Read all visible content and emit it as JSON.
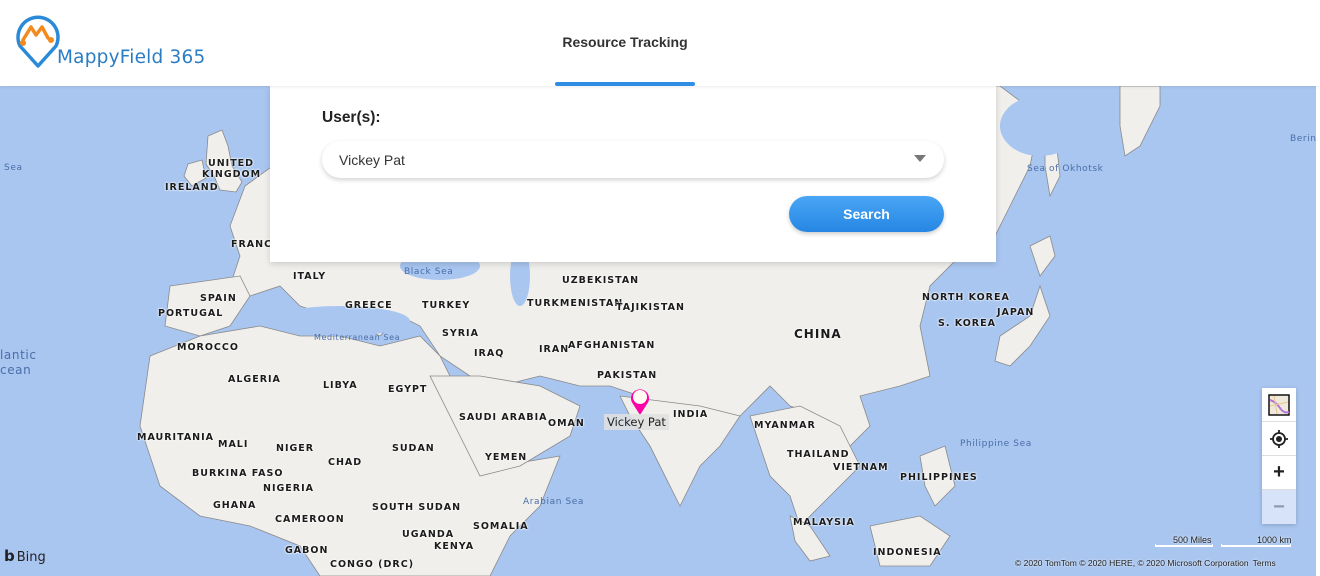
{
  "header": {
    "logo_text": "MappyField 365",
    "tabs": [
      {
        "label": "Resource Tracking",
        "active": true
      }
    ]
  },
  "panel": {
    "users_label": "User(s):",
    "selected_user": "Vickey Pat",
    "search_label": "Search"
  },
  "map": {
    "marker": {
      "label": "Vickey Pat",
      "color": "#ff00a8"
    },
    "countries": [
      "UNITED",
      "KINGDOM",
      "IRELAND",
      "FRANCE",
      "SPAIN",
      "PORTUGAL",
      "MOROCCO",
      "ALGERIA",
      "ITALY",
      "GREECE",
      "TURKEY",
      "LIBYA",
      "EGYPT",
      "SYRIA",
      "IRAQ",
      "IRAN",
      "AFGHANISTAN",
      "PAKISTAN",
      "UZBEKISTAN",
      "TURKMENISTAN",
      "TAJIKISTAN",
      "SAUDI ARABIA",
      "OMAN",
      "YEMEN",
      "INDIA",
      "CHINA",
      "NORTH KOREA",
      "S. KOREA",
      "JAPAN",
      "MYANMAR",
      "THAILAND",
      "VIETNAM",
      "PHILIPPINES",
      "MALAYSIA",
      "INDONESIA",
      "MAURITANIA",
      "MALI",
      "NIGER",
      "CHAD",
      "SUDAN",
      "BURKINA FASO",
      "NIGERIA",
      "GHANA",
      "CAMEROON",
      "SOUTH SUDAN",
      "SOMALIA",
      "UGANDA",
      "KENYA",
      "GABON",
      "CONGO (DRC)"
    ],
    "seas": {
      "black_sea": "Black Sea",
      "mediterranean": "Mediterranean Sea",
      "arabian": "Arabian Sea",
      "philippine": "Philippine Sea",
      "okhotsk": "Sea of Okhotsk",
      "bering": "Berin",
      "left_sea": "Sea",
      "atlantic_1": "lantic",
      "atlantic_2": "cean"
    },
    "controls": [
      "map-style",
      "locate-me",
      "zoom-in",
      "zoom-out"
    ],
    "zoom_in_glyph": "+",
    "zoom_out_glyph": "−",
    "scale_miles": "500 Miles",
    "scale_km": "1000 km",
    "copyright": "© 2020 TomTom © 2020 HERE, © 2020 Microsoft Corporation",
    "terms": "Terms",
    "provider": "Bing"
  }
}
